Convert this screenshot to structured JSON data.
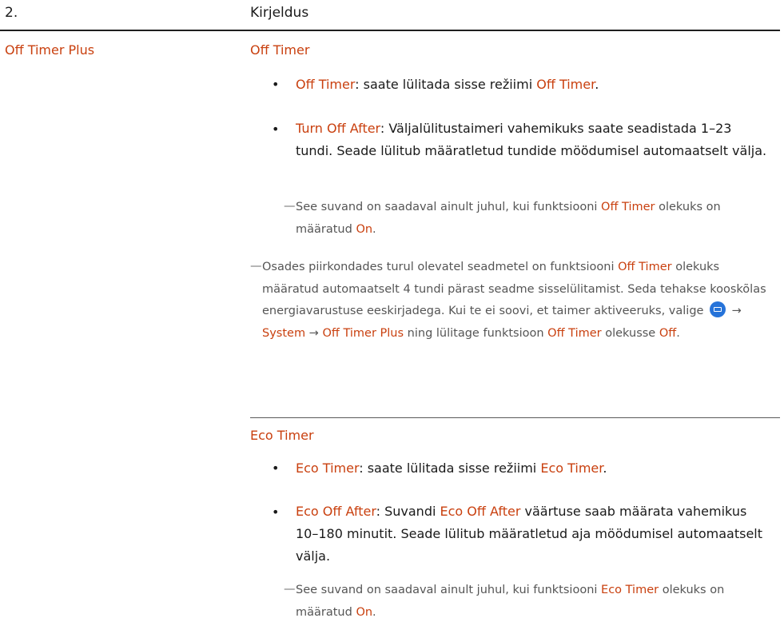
{
  "header": {
    "number": "2.",
    "description": "Kirjeldus"
  },
  "left_label": "Off Timer Plus",
  "off_timer": {
    "title": "Off Timer",
    "b1": {
      "bold": "Off Timer",
      "t1": ": saate lülitada sisse režiimi ",
      "bold2": "Off Timer",
      "t2": "."
    },
    "b2": {
      "bold": "Turn Off After",
      "text": ": Väljalülitustaimeri vahemikuks saate seadistada 1–23 tundi. Seade lülitub määratletud tundide möödumisel automaatselt välja."
    },
    "note1": {
      "t1": "See suvand on saadaval ainult juhul, kui funktsiooni ",
      "b1": "Off Timer",
      "t2": " olekuks on määratud ",
      "b2": "On",
      "t3": "."
    },
    "note2": {
      "b1": "Off Timer",
      "t_pre": "Osades piirkondades turul olevatel seadmetel on funktsiooni ",
      "t_mid": " olekuks määratud automaatselt 4 tundi pärast seadme sisselülitamist. Seda tehakse kooskõlas energiavarustuse eeskirjadega. Kui te ei soovi, et taimer aktiveeruks, valige ",
      "arrow1": " → ",
      "system": "System",
      "arrow2": " → ",
      "plus": "Off Timer Plus",
      "t_mid2": " ning lülitage funktsioon ",
      "b2": "Off Timer",
      "t_mid3": " olekusse ",
      "off": "Off",
      "t_end": "."
    }
  },
  "eco_timer": {
    "title": "Eco Timer",
    "b1": {
      "bold": "Eco Timer",
      "t1": ": saate lülitada sisse režiimi ",
      "bold2": "Eco Timer",
      "t2": "."
    },
    "b2": {
      "bold": "Eco Off After",
      "t1": ": Suvandi ",
      "bold2": "Eco Off After",
      "t2": " väärtuse saab määrata vahemikus 10–180 minutit. Seade lülitub määratletud aja möödumisel automaatselt välja."
    },
    "note": {
      "t1": "See suvand on saadaval ainult juhul, kui funktsiooni ",
      "b1": "Eco Timer",
      "t2": " olekuks on määratud ",
      "b2": "On",
      "t3": "."
    }
  },
  "icons": {
    "menu": "menu-icon",
    "dash": "em-dash-glyph",
    "bullet": "bullet-glyph"
  },
  "colors": {
    "accent": "#c9400f",
    "text": "#1a1a1a",
    "note": "#555555",
    "menu_icon": "#2673d9"
  }
}
